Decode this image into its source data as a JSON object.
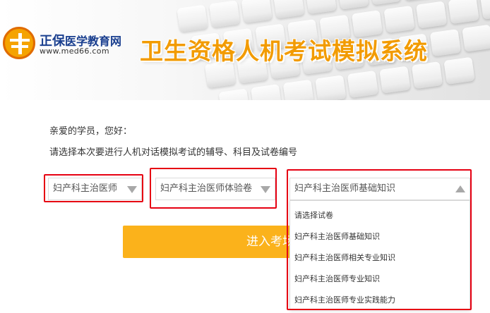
{
  "header": {
    "brand_name": "正保",
    "brand_sub": "医学教育网",
    "brand_url": "www.med66.com",
    "system_title": "卫生资格人机考试模拟系统"
  },
  "main": {
    "greeting": "亲爱的学员，您好：",
    "instruction": "请选择本次要进行人机对话模拟考试的辅导、科目及试卷编号",
    "selects": {
      "course": {
        "value": "妇产科主治医师",
        "icon": "chevron-down-icon"
      },
      "subject": {
        "value": "妇产科主治医师体验卷",
        "icon": "chevron-down-icon"
      },
      "paper": {
        "value": "妇产科主治医师基础知识",
        "icon": "chevron-up-icon"
      }
    },
    "enter_button": "进入考场",
    "paper_options": [
      "请选择试卷",
      "妇产科主治医师基础知识",
      "妇产科主治医师相关专业知识",
      "妇产科主治医师专业知识",
      "妇产科主治医师专业实践能力"
    ]
  },
  "colors": {
    "accent": "#fbb21b",
    "title": "#f29b00",
    "brand": "#1a3f8f",
    "highlight": "#e60012"
  }
}
